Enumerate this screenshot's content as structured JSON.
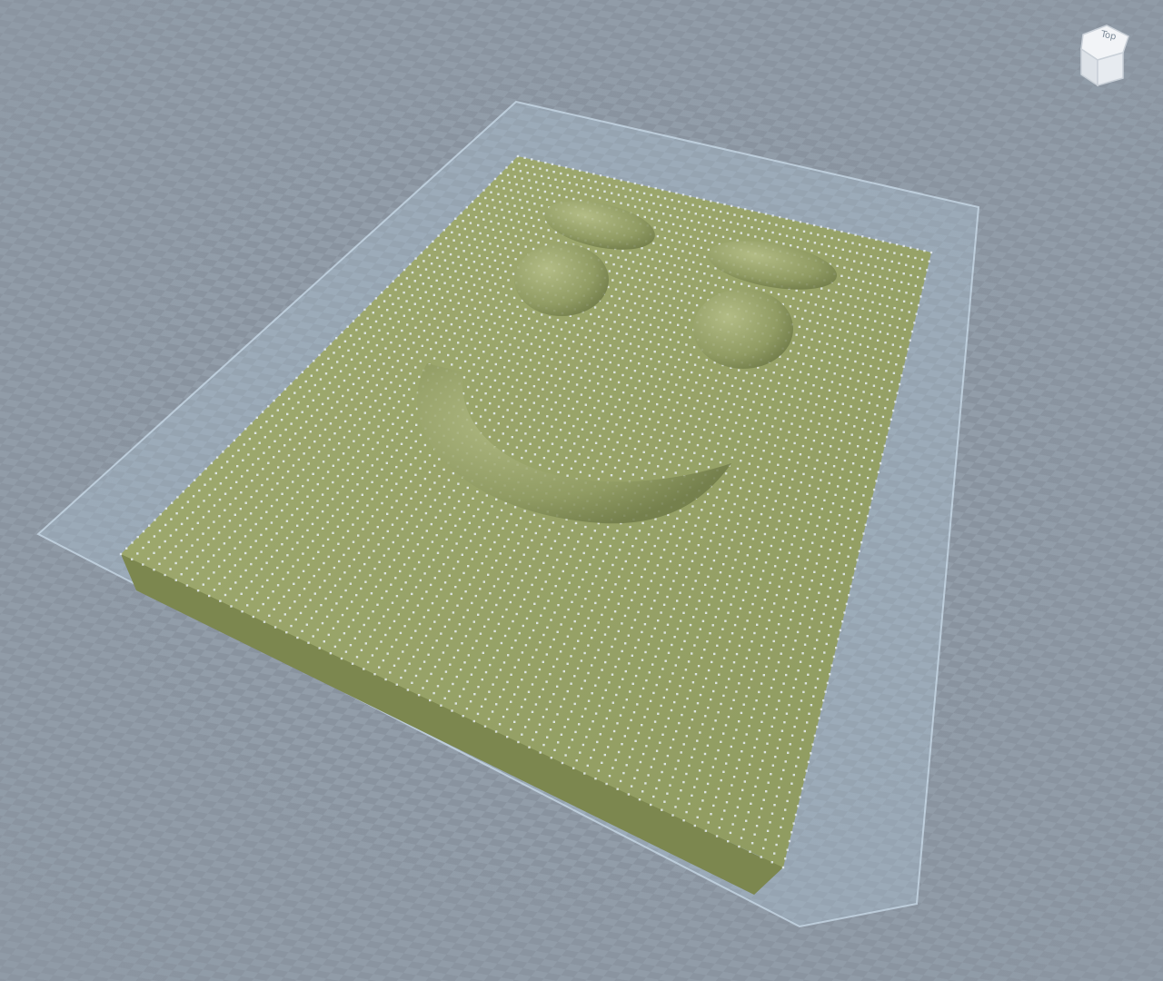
{
  "viewport": {
    "background_color": "#8e98a4",
    "floor_checker_light": "#94a0ac",
    "floor_checker_dark": "#86909c"
  },
  "terrain": {
    "surface_color": "#9aa56a",
    "surface_shade_color": "#7f8b56",
    "side_color": "#7c874f",
    "point_marker_color": "#e8eef6",
    "bounding_box_color": "#b8d0e2",
    "features": [
      "left-eye",
      "right-eye",
      "left-eyebrow",
      "right-eyebrow",
      "smile"
    ]
  },
  "view_cube": {
    "label": "Top",
    "icon": "view-cube-icon",
    "face_color": "#f2f4f7",
    "edge_color": "#c9d0d8"
  }
}
